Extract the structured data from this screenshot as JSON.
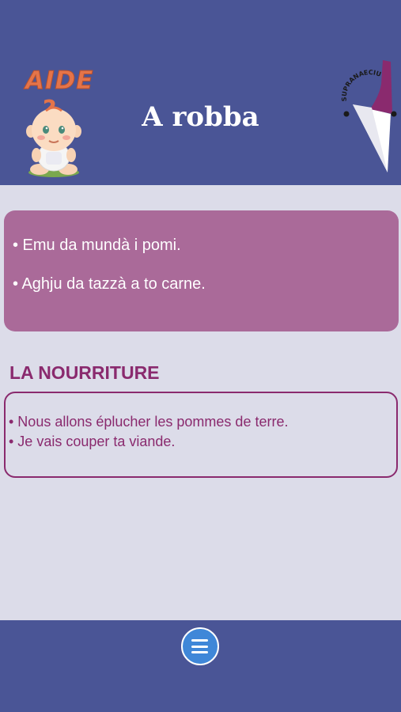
{
  "header": {
    "help_badge": "AIDE",
    "title": "A robba",
    "logo_text": "SUPRANAECIU",
    "icons": [
      "baby-help-icon",
      "logo-icon"
    ]
  },
  "phrases_corsican": [
    "• Emu da mundà i pomi.",
    "• Aghju da tazzà a to carne."
  ],
  "section": {
    "title": "LA NOURRITURE",
    "phrases_french": [
      "• Nous allons éplucher les pommes de terre.",
      "• Je vais couper ta viande."
    ]
  },
  "footer": {
    "menu_icon": "hamburger-menu-icon"
  },
  "colors": {
    "header_bg": "#4a5596",
    "page_bg": "#dcdce9",
    "pink_card": "#aa6a99",
    "accent": "#8a2a6e",
    "aide_orange": "#e4744a",
    "menu_blue": "#3f87d8"
  }
}
